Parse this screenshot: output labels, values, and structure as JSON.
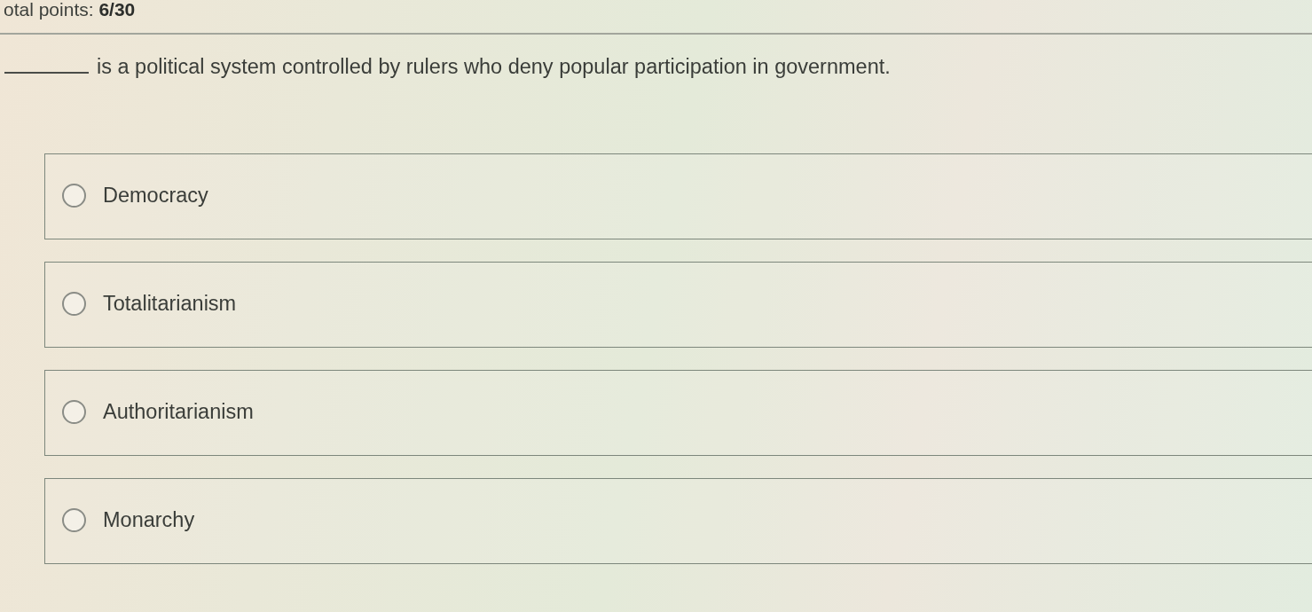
{
  "header": {
    "total_points": "otal points: **6/30**"
  },
  "question": {
    "text": "is a political system controlled by rulers who deny popular participation in government."
  },
  "options": [
    {
      "label": "Democracy",
      "selected": false
    },
    {
      "label": "Totalitarianism",
      "selected": false
    },
    {
      "label": "Authoritarianism",
      "selected": false
    },
    {
      "label": "Monarchy",
      "selected": false
    }
  ]
}
